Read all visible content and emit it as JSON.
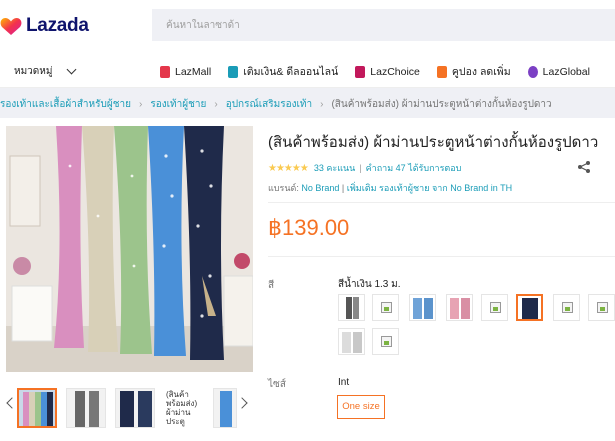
{
  "header": {
    "logo_text": "Lazada",
    "search_placeholder": "ค้นหาในลาซาด้า"
  },
  "nav": {
    "categories_label": "หมวดหมู่",
    "links": [
      {
        "label": "LazMall",
        "icon": "lazmall-icon",
        "color": "#e4374b"
      },
      {
        "label": "เติมเงิน& ดีลออนไลน์",
        "icon": "topup-icon",
        "color": "#1a9cb7"
      },
      {
        "label": "LazChoice",
        "icon": "lazchoice-icon",
        "color": "#c2185b"
      },
      {
        "label": "คูปอง ลดเพิ่ม",
        "icon": "coupon-icon",
        "color": "#f57224"
      },
      {
        "label": "LazGlobal",
        "icon": "lazglobal-icon",
        "color": "#7b3fc4"
      }
    ]
  },
  "breadcrumb": {
    "items": [
      "รองเท้าและเสื้อผ้าสำหรับผู้ชาย",
      "รองเท้าผู้ชาย",
      "อุปกรณ์เสริมรองเท้า"
    ],
    "current": "(สินค้าพร้อมส่ง) ผ้าม่านประตูหน้าต่างกั้นห้องรูปดาว"
  },
  "product": {
    "title": "(สินค้าพร้อมส่ง) ผ้าม่านประตูหน้าต่างกั้นห้องรูปดาว",
    "rating_count": "33 คะแนน",
    "answered": "คำถาม 47 ได้รับการตอบ",
    "brand_label": "แบรนด์:",
    "brand": "No Brand",
    "more_from": "เพิ่มเติม รองเท้าผู้ชาย จาก No Brand in TH",
    "price": "฿139.00",
    "color_label": "สี",
    "color_selected": "สีน้ำเงิน 1.3 ม.",
    "size_label": "ไซส์",
    "size_value": "Int",
    "size_option": "One size",
    "thumb_alt_text": "(สินค้าพร้อมส่ง) ผ้าม่านประตู"
  },
  "colors": {
    "accent": "#f57224",
    "link": "#1a9cb7",
    "curtains": [
      "#d98fbf",
      "#d8d0b8",
      "#9cc48c",
      "#4a90d8",
      "#1f2a4a"
    ]
  }
}
